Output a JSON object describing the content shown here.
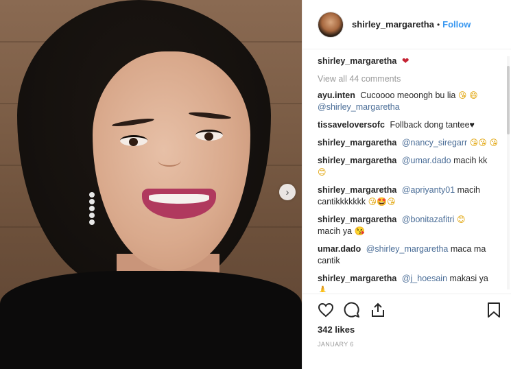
{
  "header": {
    "username": "shirley_margaretha",
    "separator": "•",
    "follow_label": "Follow"
  },
  "caption": {
    "username": "shirley_margaretha",
    "emoji": "❤"
  },
  "view_all_label": "View all 44 comments",
  "comments": [
    {
      "user": "ayu.inten",
      "text": "Cucoooo meoongh bu lia",
      "emoji": "😘 😄",
      "mention": "@shirley_margaretha",
      "text2": ""
    },
    {
      "user": "tissaveloversofc",
      "text": "Follback dong tantee",
      "emoji": "♥",
      "mention": "",
      "text2": ""
    },
    {
      "user": "shirley_margaretha",
      "text": "",
      "emoji": "😘😘 😘",
      "mention": "@nancy_siregarr",
      "text2": ""
    },
    {
      "user": "shirley_margaretha",
      "text": "",
      "emoji": "😊",
      "mention": "@umar.dado",
      "text2": "macih kk"
    },
    {
      "user": "shirley_margaretha",
      "text": "",
      "emoji": "😘🤩😘",
      "mention": "@apriyanty01",
      "text2": "macih cantikkkkkkk"
    },
    {
      "user": "shirley_margaretha",
      "text": "",
      "emoji": "😊",
      "mention": "@bonitazafitri",
      "text2": "macih ya 😘"
    },
    {
      "user": "umar.dado",
      "text": "",
      "emoji": "",
      "mention": "@shirley_margaretha",
      "text2": "maca ma cantik"
    },
    {
      "user": "shirley_margaretha",
      "text": "",
      "emoji": "🙏",
      "mention": "@j_hoesain",
      "text2": "makasi ya"
    }
  ],
  "likes_label": "342 likes",
  "date_label": "JANUARY 6",
  "icons": {
    "like": "heart-icon",
    "comment": "comment-icon",
    "share": "share-icon",
    "save": "bookmark-icon",
    "next": "chevron-right-icon"
  },
  "colors": {
    "link": "#3897f0",
    "mention": "#4a6d97",
    "muted": "#999999"
  }
}
